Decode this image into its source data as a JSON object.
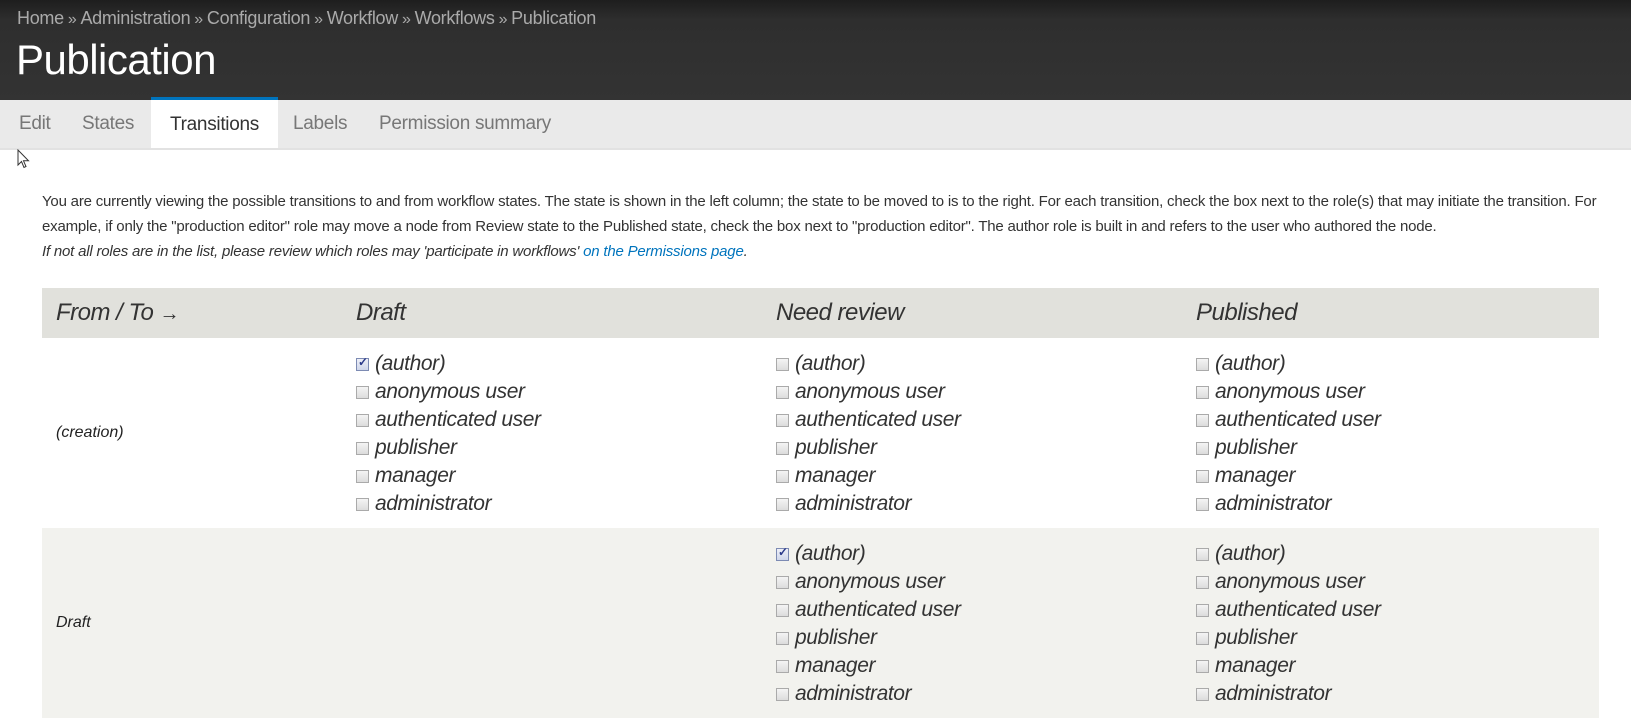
{
  "breadcrumb": [
    "Home",
    "Administration",
    "Configuration",
    "Workflow",
    "Workflows",
    "Publication"
  ],
  "breadcrumb_separator": "»",
  "page_title": "Publication",
  "tabs": [
    {
      "label": "Edit",
      "active": false
    },
    {
      "label": "States",
      "active": false
    },
    {
      "label": "Transitions",
      "active": true
    },
    {
      "label": "Labels",
      "active": false
    },
    {
      "label": "Permission summary",
      "active": false
    }
  ],
  "description": "You are currently viewing the possible transitions to and from workflow states. The state is shown in the left column; the state to be moved to is to the right. For each transition, check the box next to the role(s) that may initiate the transition. For example, if only the \"production editor\" role may move a node from Review state to the Published state, check the box next to \"production editor\". The author role is built in and refers to the user who authored the node.",
  "note": {
    "text": "If not all roles are in the list, please review which roles may 'participate in workflows' ",
    "link_text": "on the Permissions page",
    "suffix": "."
  },
  "colors": {
    "header_bg": "#333333",
    "tab_bar_bg": "#eaeaea",
    "active_tab_accent": "#0074bd",
    "link": "#0074bd",
    "table_header_bg": "#e1e1dc",
    "row_alt_bg": "#f2f2ee"
  },
  "table": {
    "corner_label": "From / To",
    "corner_arrow": "→",
    "columns": [
      "Draft",
      "Need review",
      "Published"
    ],
    "roles": [
      "(author)",
      "anonymous user",
      "authenticated user",
      "publisher",
      "manager",
      "administrator"
    ],
    "rows": [
      {
        "from": "(creation)",
        "cells": [
          {
            "to": "Draft",
            "checked": [
              true,
              false,
              false,
              false,
              false,
              false
            ]
          },
          {
            "to": "Need review",
            "checked": [
              false,
              false,
              false,
              false,
              false,
              false
            ]
          },
          {
            "to": "Published",
            "checked": [
              false,
              false,
              false,
              false,
              false,
              false
            ]
          }
        ]
      },
      {
        "from": "Draft",
        "cells": [
          null,
          {
            "to": "Need review",
            "checked": [
              true,
              false,
              false,
              false,
              false,
              false
            ]
          },
          {
            "to": "Published",
            "checked": [
              false,
              false,
              false,
              false,
              false,
              false
            ]
          }
        ]
      }
    ]
  }
}
